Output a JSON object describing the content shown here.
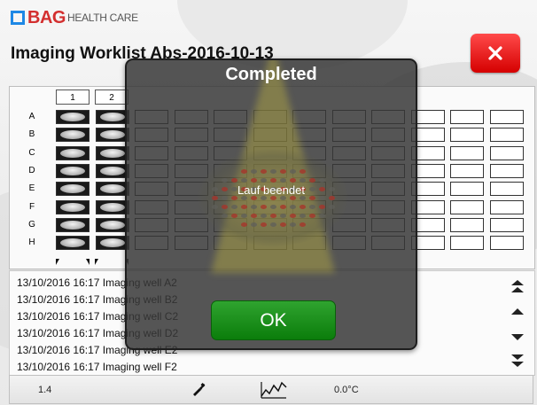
{
  "header": {
    "brand_name": "BAG",
    "brand_sub": "HEALTH CARE",
    "title": "Imaging Worklist Abs-2016-10-13"
  },
  "plate": {
    "columns": [
      "1",
      "2"
    ],
    "rows": [
      "A",
      "B",
      "C",
      "D",
      "E",
      "F",
      "G",
      "H"
    ],
    "filled_columns": 2
  },
  "log": {
    "entries": [
      "13/10/2016 16:17 Imaging well A2",
      "13/10/2016 16:17 Imaging well B2",
      "13/10/2016 16:17 Imaging well C2",
      "13/10/2016 16:17 Imaging well D2",
      "13/10/2016 16:17 Imaging well E2",
      "13/10/2016 16:17 Imaging well F2"
    ]
  },
  "status_bar": {
    "version": "1.4",
    "temperature": "0.0°C",
    "icons": [
      "tool-icon",
      "temperature-chart-icon"
    ]
  },
  "dialog": {
    "title": "Completed",
    "message": "Lauf beendet",
    "ok_label": "OK"
  },
  "colors": {
    "close_button": "#e51c1c",
    "ok_button": "#1a8c1a",
    "brand_blue": "#1e88e5",
    "brand_red": "#d32f2f"
  }
}
